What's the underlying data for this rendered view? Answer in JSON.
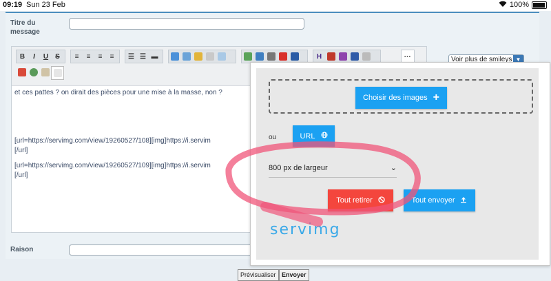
{
  "status_bar": {
    "time": "09:19",
    "date": "Sun 23 Feb",
    "battery": "100%"
  },
  "form": {
    "title_label": "Titre du message",
    "reason_label": "Raison"
  },
  "toolbar": {
    "bold": "B",
    "italic": "I",
    "underline": "U",
    "strike": "S",
    "headline": "H"
  },
  "editor": {
    "line1": "et ces pattes ? on dirait des pièces pour une mise à la masse, non ?",
    "line2a": "[url=https://servimg.com/view/19260527/108][img]https://i.servim",
    "line2b": "[/url]",
    "line3a": "[url=https://servimg.com/view/19260527/109][img]https://i.servim",
    "line3b": "[/url]"
  },
  "smileys": {
    "label": "Voir plus de smileys"
  },
  "upload": {
    "choose_images": "Choisir des images",
    "or": "ou",
    "url": "URL",
    "width_option": "800 px de largeur",
    "remove_all": "Tout retirer",
    "send_all": "Tout envoyer",
    "logo": "servimg"
  },
  "actions": {
    "preview": "Prévisualiser",
    "send": "Envoyer"
  }
}
